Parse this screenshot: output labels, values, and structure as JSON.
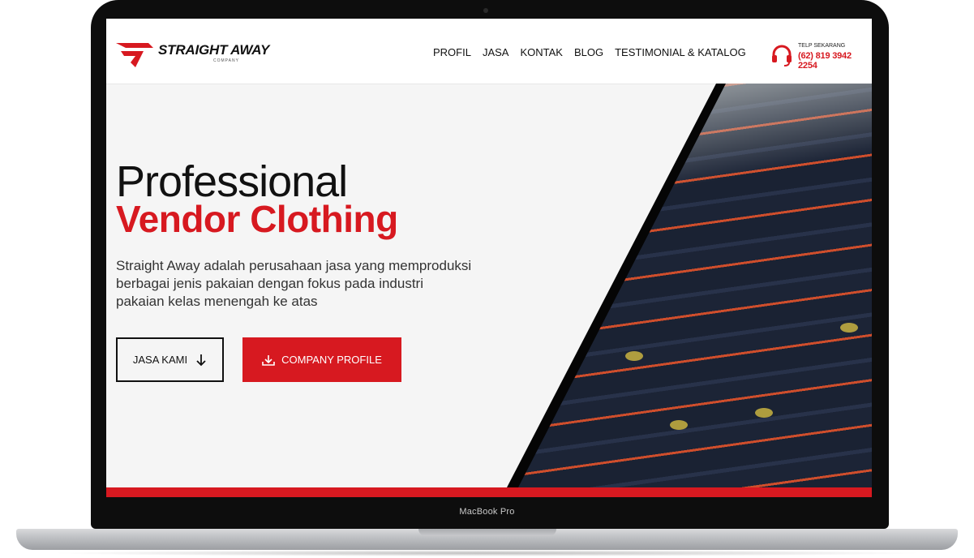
{
  "device": {
    "model_label": "MacBook Pro"
  },
  "brand": {
    "name": "STRAIGHT AWAY",
    "tagline": "COMPANY"
  },
  "nav": {
    "items": [
      "PROFIL",
      "JASA",
      "KONTAK",
      "BLOG",
      "TESTIMONIAL & KATALOG"
    ]
  },
  "contact": {
    "caption": "TELP SEKARANG",
    "phone": "(62) 819 3942 2254",
    "icon": "headset-icon"
  },
  "hero": {
    "title_line1": "Professional",
    "title_line2": "Vendor Clothing",
    "description": "Straight Away adalah perusahaan jasa yang memproduksi berbagai jenis pakaian dengan fokus pada industri pakaian kelas menengah ke atas",
    "btn_services": "JASA KAMI",
    "btn_services_icon": "arrow-down-icon",
    "btn_profile": "COMPANY PROFILE",
    "btn_profile_icon": "download-icon"
  },
  "colors": {
    "accent": "#d71920",
    "text": "#111111",
    "hero_bg": "#f5f5f5"
  }
}
